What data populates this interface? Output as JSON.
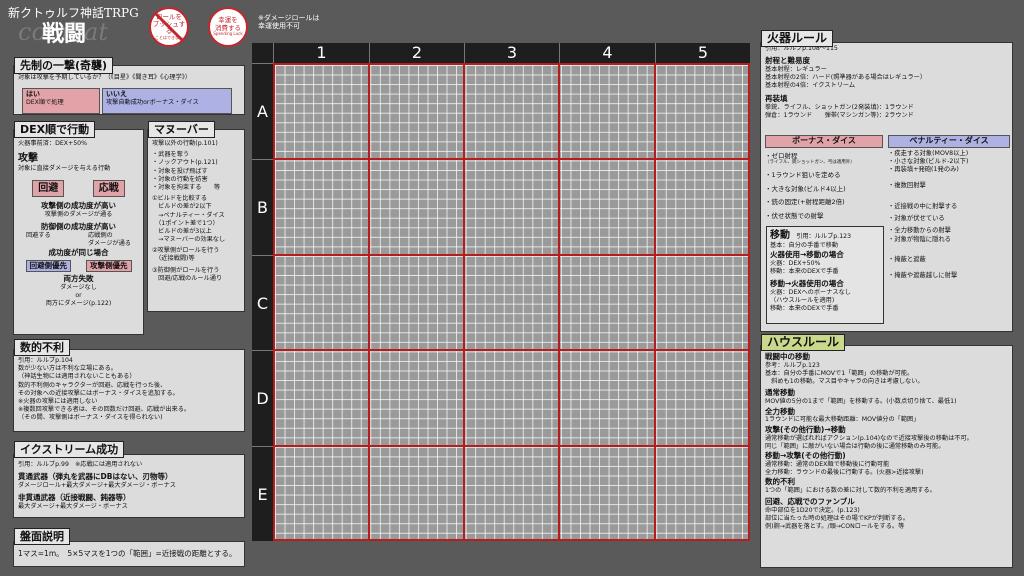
{
  "header": {
    "subtitle": "新クトゥルフ神話TRPG",
    "title": "戦闘",
    "watermark": "combat",
    "badge1": {
      "line1": "ロールを",
      "line2": "プッシュする",
      "line3": "ことはできない"
    },
    "badge2": {
      "line1": "幸運を",
      "line2": "消費する",
      "line3": "Spending Luck"
    },
    "note": {
      "line1": "※ダメージロールは",
      "line2": "幸運使用不可"
    }
  },
  "grid": {
    "columns": [
      "1",
      "2",
      "3",
      "4",
      "5"
    ],
    "rows": [
      "A",
      "B",
      "C",
      "D",
      "E"
    ]
  },
  "surprise": {
    "title": "先制の一撃(奇襲)",
    "question": "対象は攻撃を予期しているか？（《目星》《聞き耳》《心理学》）",
    "yes_label": "はい",
    "yes_desc": "DEX順で処理",
    "no_label": "いいえ",
    "no_desc": "攻撃自動成功orボーナス・ダイス"
  },
  "dex": {
    "title": "DEX順で行動",
    "firearms": "火器事前済：DEX+50%",
    "attack_title": "攻撃",
    "attack_desc": "対象に直接ダメージを与える行動",
    "evade": "回避",
    "counter": "応戦",
    "att_high1": "攻撃側の成功度が高い",
    "att_high1_desc": "攻撃側のダメージが通る",
    "def_high": "防御側の成功度が高い",
    "def_evade": "回避する",
    "def_counter1": "応戦側の",
    "def_counter2": "ダメージが通る",
    "same_level": "成功度が同じ場合",
    "evade_first": "回避側優先",
    "attack_first": "攻撃側優先",
    "both_fail": "両方失敗",
    "no_damage": "ダメージなし",
    "or": "or",
    "both_damage": "両方にダメージ(p.122)"
  },
  "maneuver": {
    "title": "マヌーバー",
    "lines": [
      "攻撃以外の行動(p.101)",
      "・武器を奪う",
      "・ノックアウト(p.121)",
      "・対象を投げ飛ばす",
      "・対象の行動を妨害",
      "・対象を拘束する　　等",
      "①ビルドを比較する",
      "　ビルドの差が2以下",
      "　→ペナルティー・ダイス",
      "　（1ポイント差で1つ）",
      "　ビルドの差が3以上",
      "　→マヌーバーの効果なし",
      "②攻撃側がロールを行う",
      "　（近接戦闘)等",
      "③防御側がロールを行う",
      "　回避/応戦のルール通り"
    ]
  },
  "outnumber": {
    "title": "数的不利",
    "lines": [
      "引用：ルルブp.104",
      "数が少ない方は不利な立場にある。",
      "（神話生物には適用されないこともある）",
      "数的不利側のキャラクターが回避、応戦を行った後、",
      "その対象への近接攻撃にはボーナス・ダイスを追加する。",
      "※火器の攻撃には適用しない",
      "※複数回攻撃できる者は、その回数だけ回避、応戦が出来る。",
      "（その間、攻撃側はボーナス・ダイスを得られない)"
    ]
  },
  "extreme": {
    "title": "イクストリーム成功",
    "lines": [
      "引用：ルルブp.99　※応戦には適用されない",
      "貫通武器（弾丸を武器にDBはない、刃物等）",
      "ダメージロール+最大ダメージ+最大ダメージ・ボーナス",
      "非貫通武器（近接戦闘、鈍器等）",
      "最大ダメージ+最大ダメージ・ボーナス"
    ]
  },
  "board": {
    "title": "盤面説明",
    "text": "1マス=1m。　5×5マスを1つの「範囲」=近接戦の距離とする。"
  },
  "firearms": {
    "title": "火器ルール",
    "lines": [
      "引用：ルルブp.108～115",
      "射程と難易度",
      "基本射程：レギュラー",
      "基本射程の2倍：ハード(照準器がある場合はレギュラー）",
      "基本射程の4倍：イクストリーム",
      "再装填",
      "拳銃、ライフル、ショットガン(2発装填)：1ラウンド",
      "弾倉：1ラウンド　　弾帯(マシンガン等)：2ラウンド"
    ],
    "bonus_title": "ボーナス・ダイス",
    "bonus": [
      "・ゼロ射程",
      "（ライフル、銃ショットガン、弓は適用外）",
      "・1ラウンド狙いを定める",
      "・大きな対象(ビルド4以上)",
      "・銃の固定(+射程距離2倍)",
      "・伏せ状態での射撃"
    ],
    "penalty_title": "ペナルティー・ダイス",
    "penalty": [
      "・疾走する対象(MOV8以上)",
      "・小さな対象(ビルド-2以下)",
      "・再装填+発砲(1発のみ)",
      "・複数回射撃",
      "・近接戦の中に射撃する",
      "・対象が伏せている",
      "・全力移動からの射撃",
      "・対象が物陰に隠れる",
      "・掩蔽と遮蔽",
      "・掩蔽や遮蔽越しに射撃"
    ]
  },
  "move": {
    "title": "移動",
    "ref": "引用：ルルブp.123",
    "lines": [
      "基本：自分の手番で移動",
      "火器使用→移動の場合",
      "火器：DEX+50%",
      "移動：本来のDEXで手番",
      "移動→火器使用の場合",
      "火器：DEXへのボーナスなし",
      "（ハウスルールを適用)",
      "移動：本来のDEXで手番"
    ]
  },
  "house": {
    "title": "ハウスルール",
    "lines": [
      "戦闘中の移動",
      "参考：ルルブp.123",
      "基本：自分の手番にMOVで1「範囲」の移動が可能。",
      "　斜めも1の移動。マス目やキャラの向きは考慮しない。",
      "通常移動",
      "MOV値の5分の1まで「範囲」を移動する。(小数点切り捨て、最低1)",
      "全力移動",
      "1ラウンドに可能な最大移動距離：MOV値分の「範囲」",
      "攻撃(その他行動)→移動",
      "通常移動が選ばれればアクション(p.104)なので近接攻撃後の移動は不可。",
      "同じ「範囲」に敵がいない場合は行動の後に通常移動のみ可能。",
      "移動→攻撃(その他行動)",
      "通常移動：通常のDEX順で移動後に行動可能",
      "全力移動：ラウンドの最後に行動する。(火器>近接攻撃)",
      "数的不利",
      "1つの「範囲」における数の差に対して数的不利を適用する。",
      "回避、応戦でのファンブル",
      "命中部位を1D20で決定。(p.123)",
      "部位に当たった時の処理はその場でKPが判断する。",
      "例)腕→武器を落とす。/頭→CONロールをする。等"
    ]
  }
}
